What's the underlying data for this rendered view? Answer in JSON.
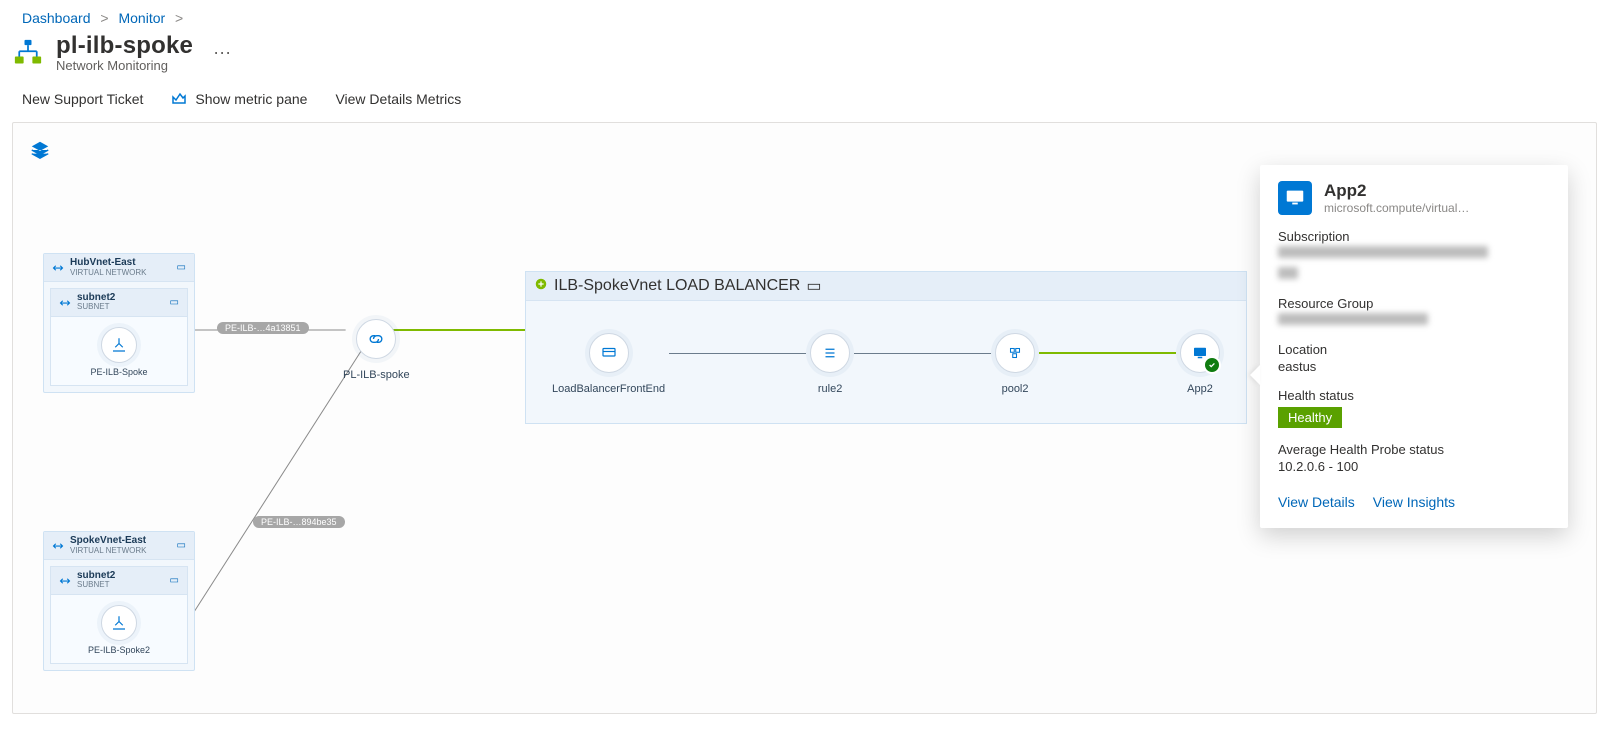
{
  "breadcrumb": {
    "items": [
      "Dashboard",
      "Monitor"
    ],
    "trailing_sep": ">"
  },
  "page": {
    "title": "pl-ilb-spoke",
    "subtitle": "Network Monitoring"
  },
  "toolbar": {
    "new_ticket": "New Support Ticket",
    "metric_pane": "Show metric pane",
    "details_metrics": "View Details Metrics"
  },
  "vnet1": {
    "name": "HubVnet-East",
    "typestr": "VIRTUAL NETWORK",
    "subnet": {
      "name": "subnet2",
      "typestr": "SUBNET",
      "node_label": "PE-ILB-Spoke"
    }
  },
  "vnet2": {
    "name": "SpokeVnet-East",
    "typestr": "VIRTUAL NETWORK",
    "subnet": {
      "name": "subnet2",
      "typestr": "SUBNET",
      "node_label": "PE-ILB-Spoke2"
    }
  },
  "central": {
    "label": "PL-ILB-spoke"
  },
  "edges": {
    "top": "PE-ILB-…4a13851",
    "bottom": "PE-ILB-…894be35"
  },
  "lb": {
    "name": "ILB-SpokeVnet",
    "typestr": "LOAD BALANCER",
    "nodes": {
      "frontend": "LoadBalancerFrontEnd",
      "rule": "rule2",
      "pool": "pool2",
      "app": "App2"
    }
  },
  "detail": {
    "title": "App2",
    "type": "microsoft.compute/virtual…",
    "labels": {
      "subscription": "Subscription",
      "rg": "Resource Group",
      "location": "Location",
      "health": "Health status",
      "probe": "Average Health Probe status"
    },
    "location": "eastus",
    "health": "Healthy",
    "probe": "10.2.0.6 - 100",
    "actions": {
      "details": "View Details",
      "insights": "View Insights"
    }
  }
}
